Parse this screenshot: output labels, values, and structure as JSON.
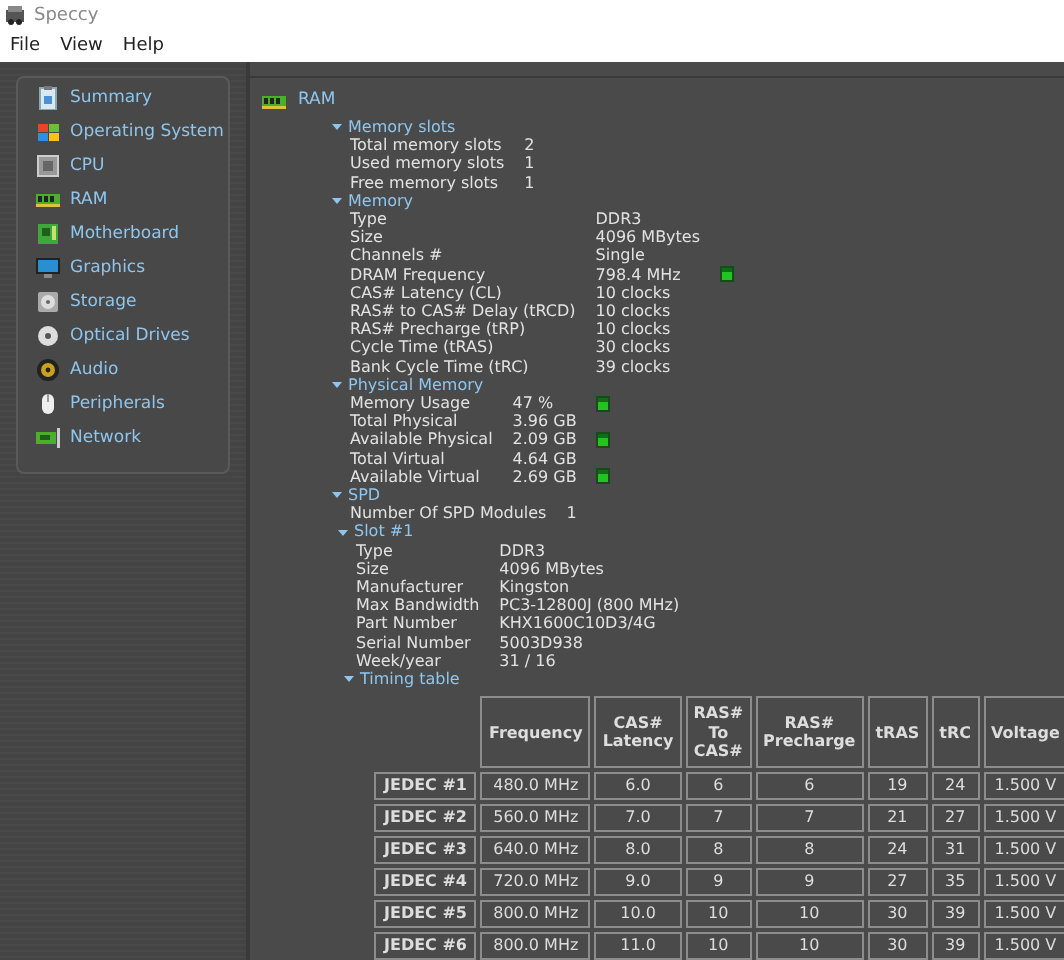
{
  "window": {
    "title": "Speccy"
  },
  "menu": [
    "File",
    "View",
    "Help"
  ],
  "sidebar": {
    "items": [
      {
        "label": "Summary"
      },
      {
        "label": "Operating System"
      },
      {
        "label": "CPU"
      },
      {
        "label": "RAM"
      },
      {
        "label": "Motherboard"
      },
      {
        "label": "Graphics"
      },
      {
        "label": "Storage"
      },
      {
        "label": "Optical Drives"
      },
      {
        "label": "Audio"
      },
      {
        "label": "Peripherals"
      },
      {
        "label": "Network"
      }
    ]
  },
  "content": {
    "title": "RAM",
    "sections": [
      {
        "title": "Memory slots",
        "expanded": true,
        "rows": [
          {
            "label": "Total memory slots",
            "value": "2",
            "gauge": false
          },
          {
            "label": "Used memory slots",
            "value": "1",
            "gauge": false
          },
          {
            "label": "Free memory slots",
            "value": "1",
            "gauge": false
          }
        ]
      },
      {
        "title": "Memory",
        "expanded": true,
        "rows": [
          {
            "label": "Type",
            "value": "DDR3",
            "gauge": false
          },
          {
            "label": "Size",
            "value": "4096 MBytes",
            "gauge": false
          },
          {
            "label": "Channels #",
            "value": "Single",
            "gauge": false
          },
          {
            "label": "DRAM Frequency",
            "value": "798.4 MHz",
            "gauge": true
          },
          {
            "label": "CAS# Latency (CL)",
            "value": "10 clocks",
            "gauge": false
          },
          {
            "label": "RAS# to CAS# Delay (tRCD)",
            "value": "10 clocks",
            "gauge": false
          },
          {
            "label": "RAS# Precharge (tRP)",
            "value": "10 clocks",
            "gauge": false
          },
          {
            "label": "Cycle Time (tRAS)",
            "value": "30 clocks",
            "gauge": false
          },
          {
            "label": "Bank Cycle Time (tRC)",
            "value": "39 clocks",
            "gauge": false
          }
        ]
      },
      {
        "title": "Physical Memory",
        "expanded": true,
        "rows": [
          {
            "label": "Memory Usage",
            "value": "47 %",
            "gauge": true
          },
          {
            "label": "Total Physical",
            "value": "3.96 GB",
            "gauge": false
          },
          {
            "label": "Available Physical",
            "value": "2.09 GB",
            "gauge": true
          },
          {
            "label": "Total Virtual",
            "value": "4.64 GB",
            "gauge": false
          },
          {
            "label": "Available Virtual",
            "value": "2.69 GB",
            "gauge": true
          }
        ]
      },
      {
        "title": "SPD",
        "expanded": true,
        "rows": [
          {
            "label": "Number Of SPD Modules",
            "value": "1",
            "gauge": false
          }
        ],
        "children": [
          {
            "title": "Slot #1",
            "expanded": true,
            "rows": [
              {
                "label": "Type",
                "value": "DDR3",
                "gauge": false
              },
              {
                "label": "Size",
                "value": "4096 MBytes",
                "gauge": false
              },
              {
                "label": "Manufacturer",
                "value": "Kingston",
                "gauge": false
              },
              {
                "label": "Max Bandwidth",
                "value": "PC3-12800J (800 MHz)",
                "gauge": false
              },
              {
                "label": "Part Number",
                "value": "KHX1600C10D3/4G",
                "gauge": false
              },
              {
                "label": "Serial Number",
                "value": "5003D938",
                "gauge": false
              },
              {
                "label": "Week/year",
                "value": "31 / 16",
                "gauge": false
              }
            ],
            "children": [
              {
                "title": "Timing table",
                "expanded": true,
                "table": {
                  "columns": [
                    "Frequency",
                    "CAS#\nLatency",
                    "RAS#\nTo\nCAS#",
                    "RAS#\nPrecharge",
                    "tRAS",
                    "tRC",
                    "Voltage"
                  ],
                  "rows": [
                    {
                      "name": "JEDEC #1",
                      "cells": [
                        "480.0 MHz",
                        "6.0",
                        "6",
                        "6",
                        "19",
                        "24",
                        "1.500 V"
                      ]
                    },
                    {
                      "name": "JEDEC #2",
                      "cells": [
                        "560.0 MHz",
                        "7.0",
                        "7",
                        "7",
                        "21",
                        "27",
                        "1.500 V"
                      ]
                    },
                    {
                      "name": "JEDEC #3",
                      "cells": [
                        "640.0 MHz",
                        "8.0",
                        "8",
                        "8",
                        "24",
                        "31",
                        "1.500 V"
                      ]
                    },
                    {
                      "name": "JEDEC #4",
                      "cells": [
                        "720.0 MHz",
                        "9.0",
                        "9",
                        "9",
                        "27",
                        "35",
                        "1.500 V"
                      ]
                    },
                    {
                      "name": "JEDEC #5",
                      "cells": [
                        "800.0 MHz",
                        "10.0",
                        "10",
                        "10",
                        "30",
                        "39",
                        "1.500 V"
                      ]
                    },
                    {
                      "name": "JEDEC #6",
                      "cells": [
                        "800.0 MHz",
                        "11.0",
                        "10",
                        "10",
                        "30",
                        "39",
                        "1.500 V"
                      ]
                    }
                  ]
                }
              }
            ]
          }
        ]
      }
    ]
  }
}
